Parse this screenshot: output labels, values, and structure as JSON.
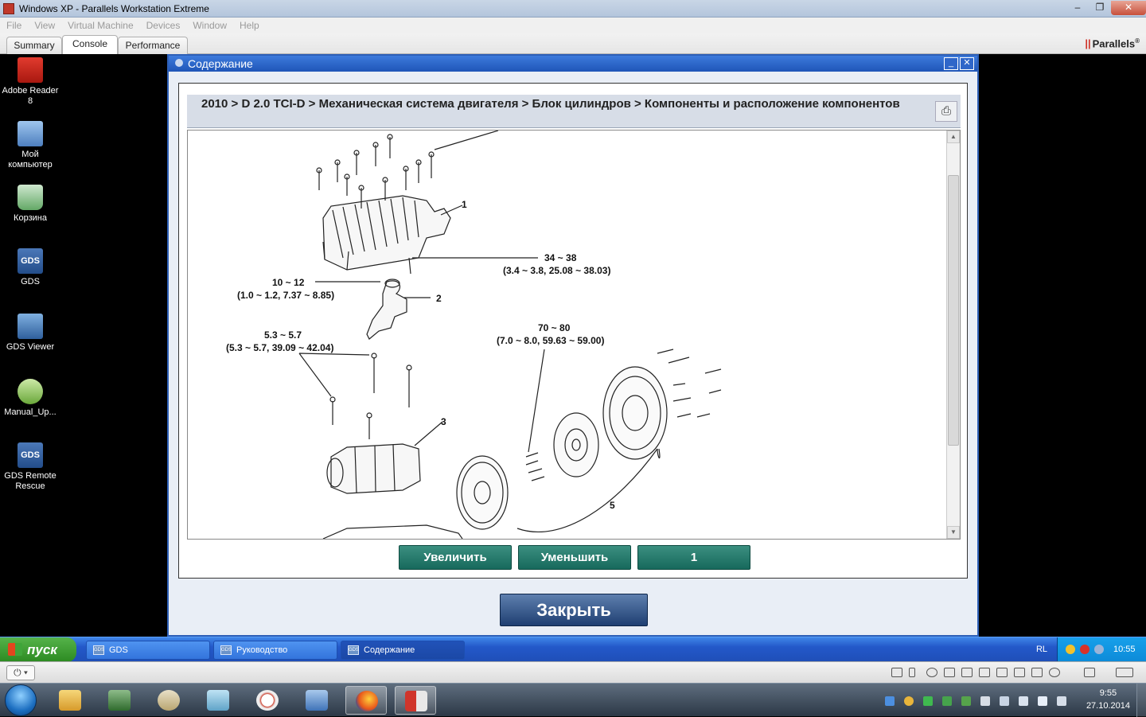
{
  "host_window": {
    "title": "Windows XP - Parallels Workstation Extreme",
    "controls": {
      "minimize": "–",
      "restore": "❐",
      "close": "✕"
    }
  },
  "menu": [
    "File",
    "View",
    "Virtual Machine",
    "Devices",
    "Window",
    "Help"
  ],
  "tabs": [
    {
      "label": "Summary",
      "active": false
    },
    {
      "label": "Console",
      "active": true
    },
    {
      "label": "Performance",
      "active": false
    }
  ],
  "brand": {
    "name": "Parallels",
    "mark": "®"
  },
  "desktop_icons": [
    {
      "label": "Adobe Reader 8",
      "icon": "pdf-icon"
    },
    {
      "label": "Мой компьютер",
      "icon": "computer-icon"
    },
    {
      "label": "Корзина",
      "icon": "recycle-bin-icon"
    },
    {
      "label": "GDS",
      "icon": "gds-icon",
      "glyph": "GDS"
    },
    {
      "label": "GDS Viewer",
      "icon": "gds-viewer-icon"
    },
    {
      "label": "Manual_Up...",
      "icon": "manual-update-icon"
    },
    {
      "label": "GDS Remote Rescue",
      "icon": "gds-remote-icon",
      "glyph": "GDS"
    }
  ],
  "dialog": {
    "title": "Содержание",
    "breadcrumb": "2010 > D 2.0 TCI-D > Механическая система двигателя > Блок цилиндров > Компоненты и расположение компонентов",
    "print_icon": "⎙",
    "diagram": {
      "callouts": {
        "c1": "1",
        "c2": "2",
        "c3": "3",
        "c5": "5",
        "t1_line1": "34 ~ 38",
        "t1_line2": "(3.4 ~ 3.8, 25.08 ~ 38.03)",
        "t2_line1": "10 ~ 12",
        "t2_line2": "(1.0 ~ 1.2, 7.37 ~ 8.85)",
        "t3_line1": "5.3 ~ 5.7",
        "t3_line2": "(5.3 ~ 5.7, 39.09 ~ 42.04)",
        "t4_line1": "70 ~ 80",
        "t4_line2": "(7.0 ~ 8.0, 59.63 ~ 59.00)"
      }
    },
    "buttons": {
      "zoom_in": "Увеличить",
      "zoom_out": "Уменьшить",
      "page": "1"
    },
    "close_label": "Закрыть"
  },
  "xp_taskbar": {
    "start_label": "пуск",
    "items": [
      {
        "label": "GDS",
        "active": false
      },
      {
        "label": "Руководство",
        "active": false
      },
      {
        "label": "Содержание",
        "active": true
      }
    ],
    "task_icon_glyph": "GDS",
    "language": "RL",
    "time": "10:55"
  },
  "host_taskbar": {
    "time": "9:55",
    "date": "27.10.2014"
  },
  "colors": {
    "xp_blue": "#2358c9",
    "teal_button": "#17695c",
    "close_button": "#1f3f72"
  }
}
